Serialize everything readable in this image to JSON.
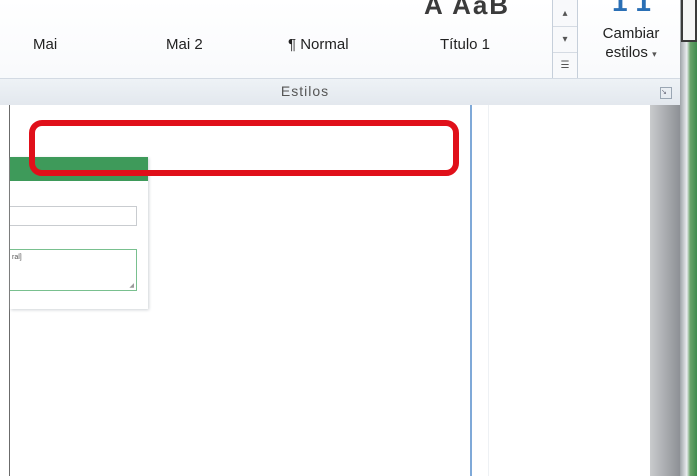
{
  "ribbon": {
    "top_glyphs": "A AaB",
    "top_blue_glyph": "1 1",
    "styles": [
      "Mai",
      "Mai 2",
      "¶ Normal",
      "Título 1"
    ],
    "change_styles_line1": "Cambiar",
    "change_styles_line2": "estilos",
    "change_styles_arrow": "▾",
    "group_label": "Estilos",
    "scroll_up": "▴",
    "scroll_down": "▾",
    "scroll_more": "☰",
    "launcher_icon": "↘"
  },
  "form_card": {
    "textarea_text": "ral]",
    "resize_mark": "◢"
  },
  "colors": {
    "card_header": "#3e9a5a",
    "highlight": "#e0101a",
    "split_line": "#7fa9d8"
  }
}
